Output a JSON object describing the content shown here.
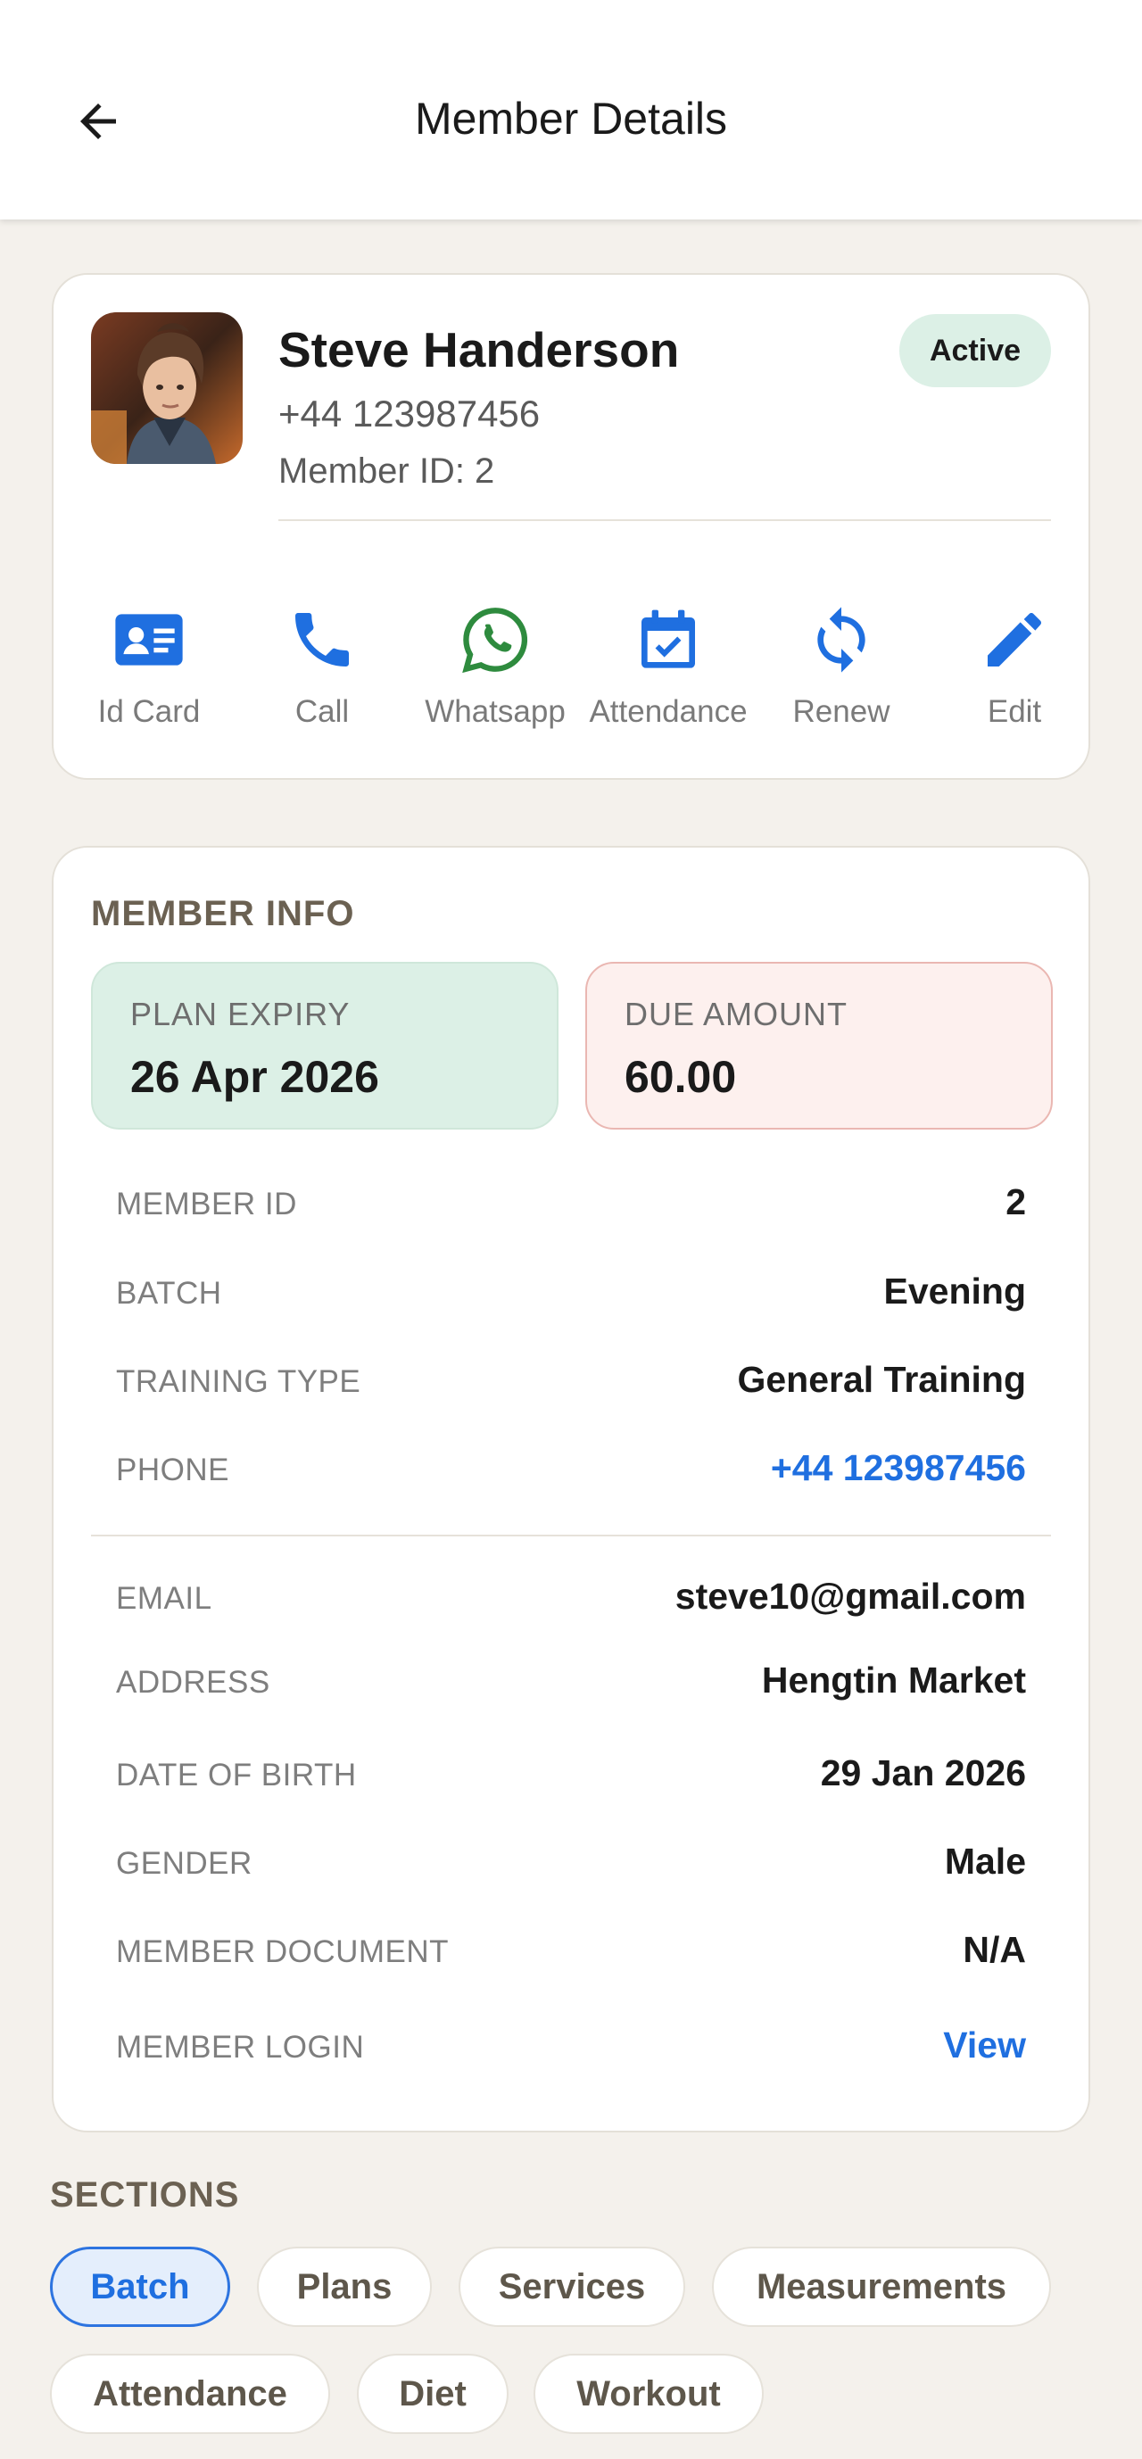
{
  "app_bar": {
    "title": "Member Details",
    "back_icon": "arrow-left-icon"
  },
  "profile": {
    "name": "Steve Handerson",
    "phone": "+44 123987456",
    "member_id_line": "Member ID: 2",
    "status": "Active",
    "avatar_alt": "member-photo"
  },
  "actions": [
    {
      "label": "Id Card",
      "icon": "id-card-icon",
      "color": "#1f6fe0"
    },
    {
      "label": "Call",
      "icon": "phone-icon",
      "color": "#1f6fe0"
    },
    {
      "label": "Whatsapp",
      "icon": "whatsapp-icon",
      "color": "#2e8b3e"
    },
    {
      "label": "Attendance",
      "icon": "calendar-check-icon",
      "color": "#1f6fe0"
    },
    {
      "label": "Renew",
      "icon": "refresh-icon",
      "color": "#1f6fe0"
    },
    {
      "label": "Edit",
      "icon": "pencil-icon",
      "color": "#1f6fe0"
    }
  ],
  "member_info": {
    "heading": "MEMBER INFO",
    "plan_expiry": {
      "label": "PLAN EXPIRY",
      "value": "26 Apr 2026"
    },
    "due_amount": {
      "label": "DUE AMOUNT",
      "value": "60.00"
    },
    "rows": [
      {
        "key": "MEMBER ID",
        "value": "2"
      },
      {
        "key": "BATCH",
        "value": "Evening"
      },
      {
        "key": "TRAINING TYPE",
        "value": "General Training"
      },
      {
        "key": "PHONE",
        "value": "+44 123987456"
      },
      {
        "key": "EMAIL",
        "value": "steve10@gmail.com"
      },
      {
        "key": "ADDRESS",
        "value": "Hengtin Market"
      },
      {
        "key": "DATE OF BIRTH",
        "value": "29 Jan 2026"
      },
      {
        "key": "GENDER",
        "value": "Male"
      },
      {
        "key": "MEMBER DOCUMENT",
        "value": "N/A"
      },
      {
        "key": "MEMBER LOGIN",
        "value": "View"
      }
    ]
  },
  "sections": {
    "heading": "SECTIONS",
    "chips": [
      "Batch",
      "Plans",
      "Services",
      "Measurements",
      "Attendance",
      "Diet",
      "Workout"
    ],
    "selected": "Batch"
  },
  "colors": {
    "accent": "#1f6fe0",
    "active_badge": "#dcf0e6",
    "due_border": "#eab7b2",
    "whatsapp": "#2e8b3e"
  }
}
